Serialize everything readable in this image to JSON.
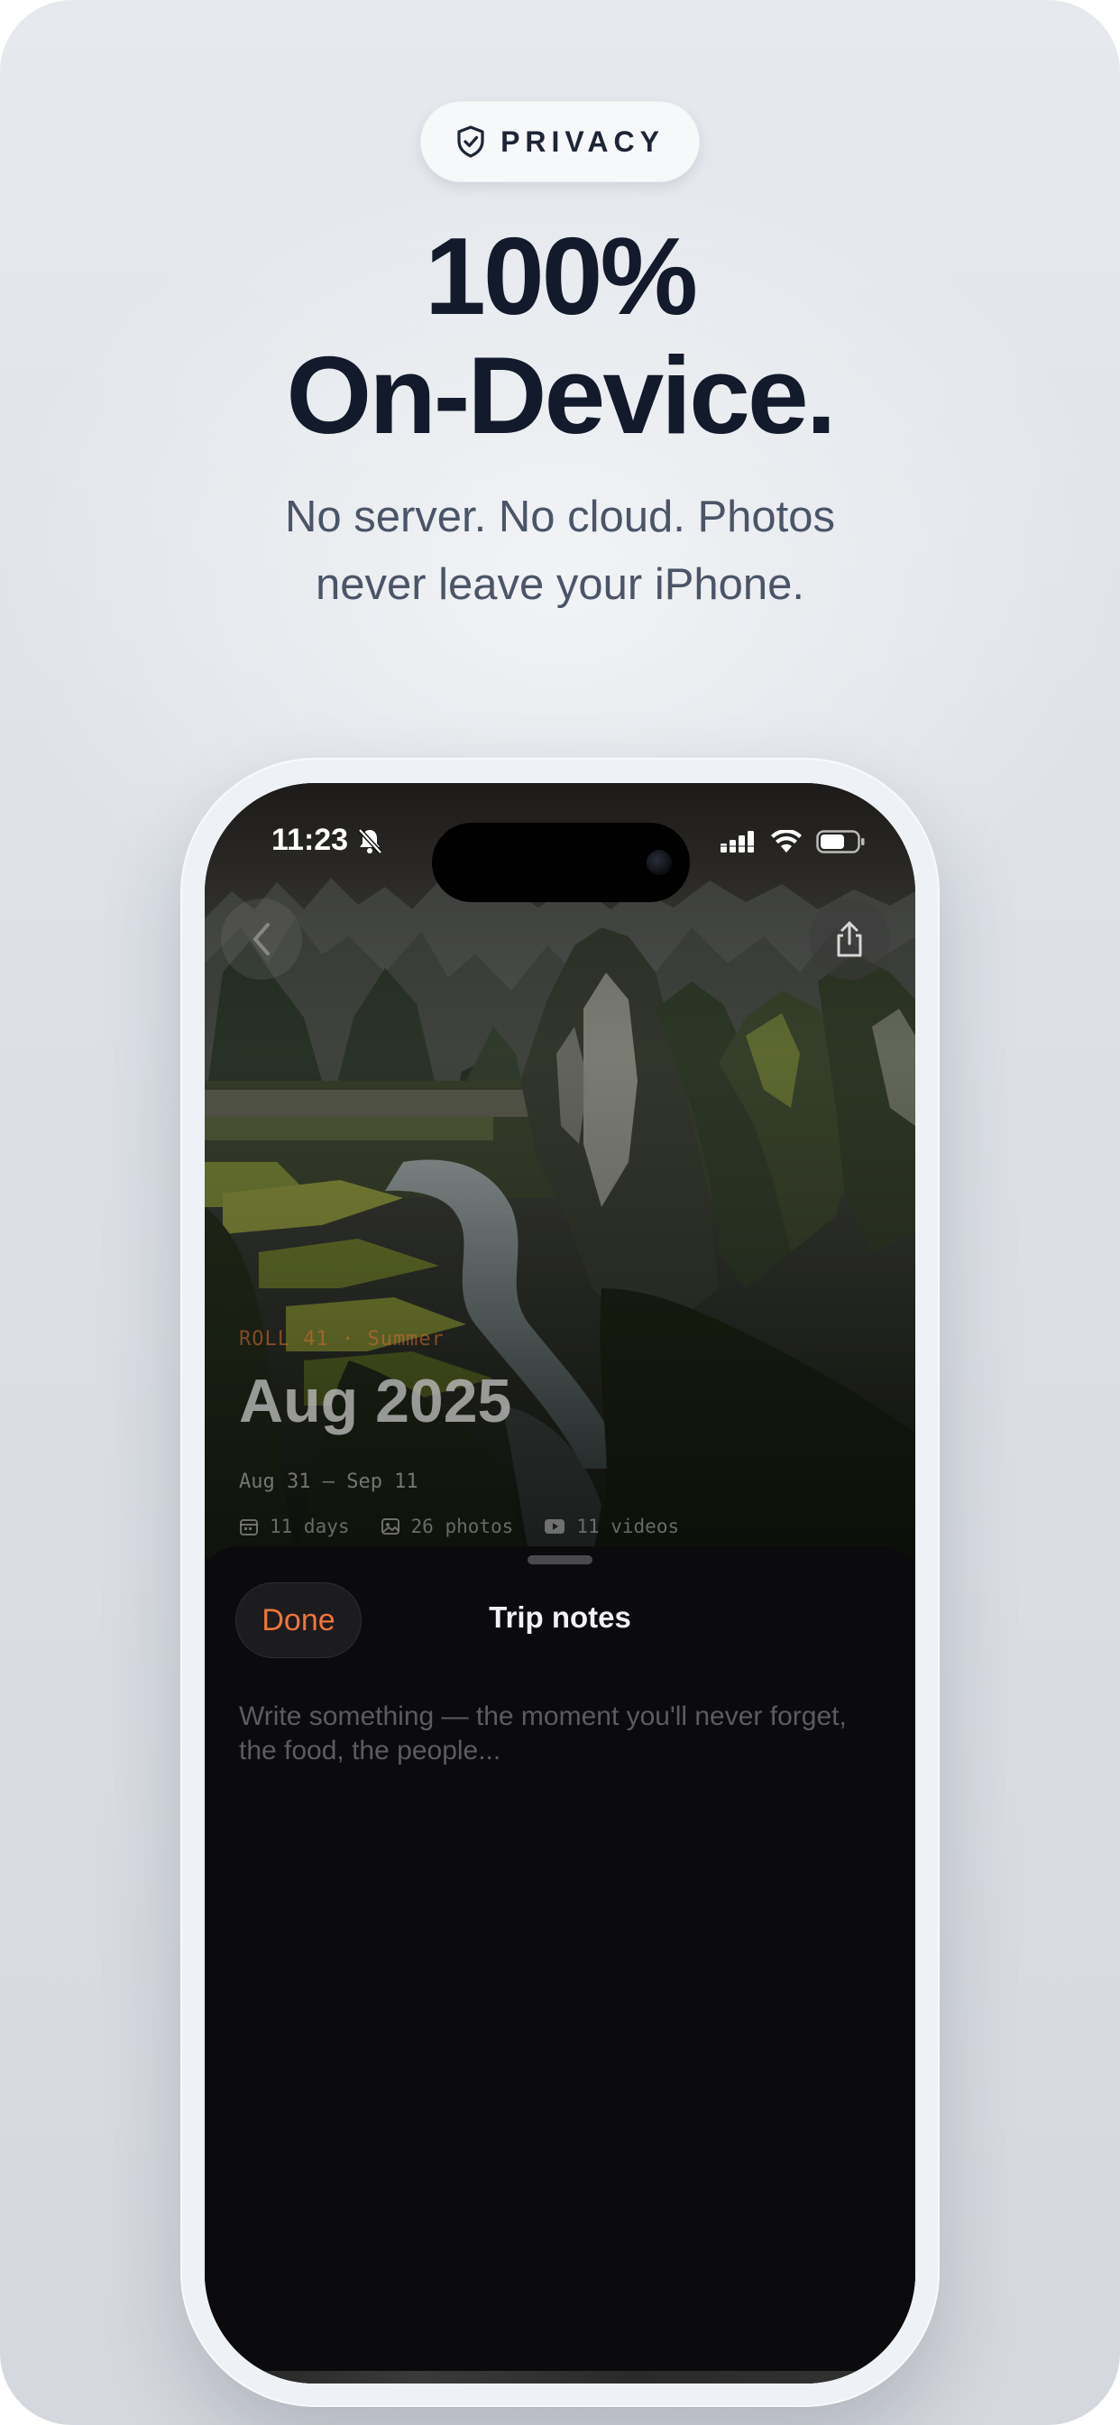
{
  "badge": {
    "label": "PRIVACY",
    "icon": "shield-check-icon"
  },
  "headline": {
    "line1": "100%",
    "line2": "On-Device."
  },
  "subtitle": {
    "line1": "No server. No cloud. Photos",
    "line2": "never leave your iPhone."
  },
  "phone": {
    "status_bar": {
      "time": "11:23",
      "icons": [
        "bell-slash-icon",
        "signal-icon",
        "wifi-icon",
        "battery-icon"
      ]
    },
    "hero": {
      "roll_label": "ROLL 41 · Summer",
      "title": "Aug 2025",
      "dates": "Aug 31 – Sep 11",
      "stats": [
        {
          "icon": "calendar-icon",
          "text": "11 days"
        },
        {
          "icon": "photo-icon",
          "text": "26 photos"
        },
        {
          "icon": "video-icon",
          "text": "11 videos"
        }
      ]
    },
    "sheet": {
      "done_label": "Done",
      "title": "Trip notes",
      "notes_placeholder": "Write something — the moment you'll never forget, the food, the people...",
      "notes_value": ""
    }
  },
  "colors": {
    "accent_orange": "#f0753a",
    "headline": "#131a2b",
    "subtitle": "#4b5568",
    "sheet_bg": "#0b0b0d"
  }
}
